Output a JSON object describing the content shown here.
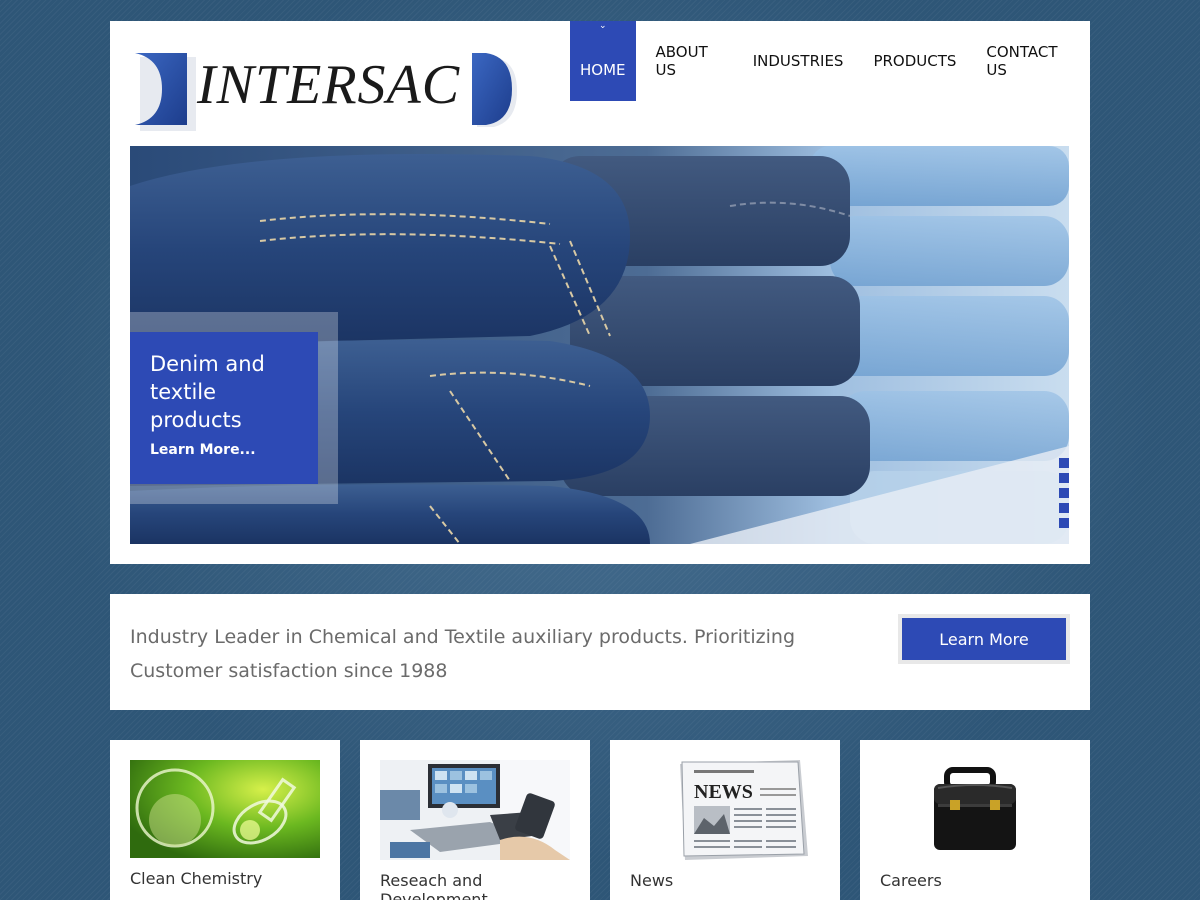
{
  "brand": {
    "logo_text": "INTERSAC",
    "accent": "#2d4ab5"
  },
  "nav": {
    "items": [
      {
        "label": "HOME",
        "active": true
      },
      {
        "label": "ABOUT US"
      },
      {
        "label": "INDUSTRIES"
      },
      {
        "label": "PRODUCTS"
      },
      {
        "label": "CONTACT US"
      }
    ]
  },
  "hero": {
    "caption_title": "Denim and textile products",
    "caption_link": "Learn More...",
    "slide_count": 5
  },
  "tagline": {
    "text": "Industry Leader in Chemical and Textile auxiliary products. Prioritizing Customer satisfaction since 1988",
    "button_label": "Learn More"
  },
  "features": [
    {
      "label": "Clean Chemistry",
      "icon": "lab-flask-image"
    },
    {
      "label": "Reseach and Development",
      "icon": "tech-devices-image"
    },
    {
      "label": "News",
      "icon": "newspaper-image"
    },
    {
      "label": "Careers",
      "icon": "briefcase-image"
    }
  ],
  "newspaper_masthead": "NEWS"
}
